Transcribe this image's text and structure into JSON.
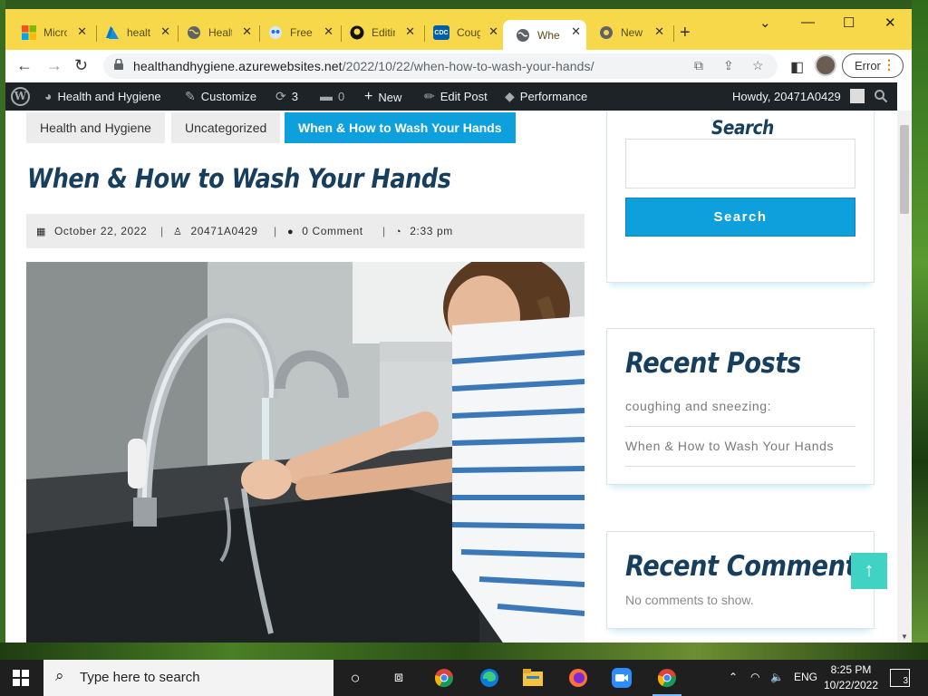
{
  "browser": {
    "tabs": [
      {
        "label": "Micro",
        "icon": "microsoft-icon",
        "color": "#f25022"
      },
      {
        "label": "healt",
        "icon": "azure-icon",
        "color": "#0078d4"
      },
      {
        "label": "Healt",
        "icon": "globe-icon",
        "color": "#5f6368"
      },
      {
        "label": "Free",
        "icon": "owl-icon",
        "color": "#1a73e8"
      },
      {
        "label": "Editin",
        "icon": "github-icon",
        "color": "#111111"
      },
      {
        "label": "Coug",
        "icon": "cdc-icon",
        "color": "#005eaa"
      },
      {
        "label": "Whe",
        "icon": "globe-icon",
        "color": "#5f6368",
        "active": true
      },
      {
        "label": "New",
        "icon": "chrome-icon",
        "color": "#5f6368"
      }
    ],
    "new_tab": "+",
    "url_host": "healthandhygiene.azurewebsites.net",
    "url_path": "/2022/10/22/when-how-to-wash-your-hands/",
    "profile_status": "Error",
    "accent": "#f6d84a"
  },
  "wpbar": {
    "site_name": "Health and Hygiene",
    "customize": "Customize",
    "updates_count": "3",
    "comments_count": "0",
    "new_label": "New",
    "edit_post": "Edit Post",
    "performance": "Performance",
    "howdy": "Howdy, 20471A0429"
  },
  "breadcrumbs": [
    "Health and Hygiene",
    "Uncategorized",
    "When & How to Wash Your Hands"
  ],
  "post": {
    "title": "When & How to Wash Your Hands",
    "date": "October 22, 2022",
    "author": "20471A0429",
    "comments": "0 Comment",
    "time": "2:33 pm",
    "image_alt": "child washing hands at sink"
  },
  "sidebar": {
    "search_title": "Search",
    "search_placeholder": "",
    "search_button": "Search",
    "recent_posts_title": "Recent Posts",
    "recent_posts": [
      "coughing and sneezing:",
      "When & How to Wash Your Hands"
    ],
    "recent_comments_title": "Recent Comments",
    "no_comments": "No comments to show."
  },
  "back_to_top": "↑",
  "taskbar": {
    "search_placeholder": "Type here to search",
    "language": "ENG",
    "time": "8:25 PM",
    "date": "10/22/2022",
    "notification_count": "3"
  }
}
